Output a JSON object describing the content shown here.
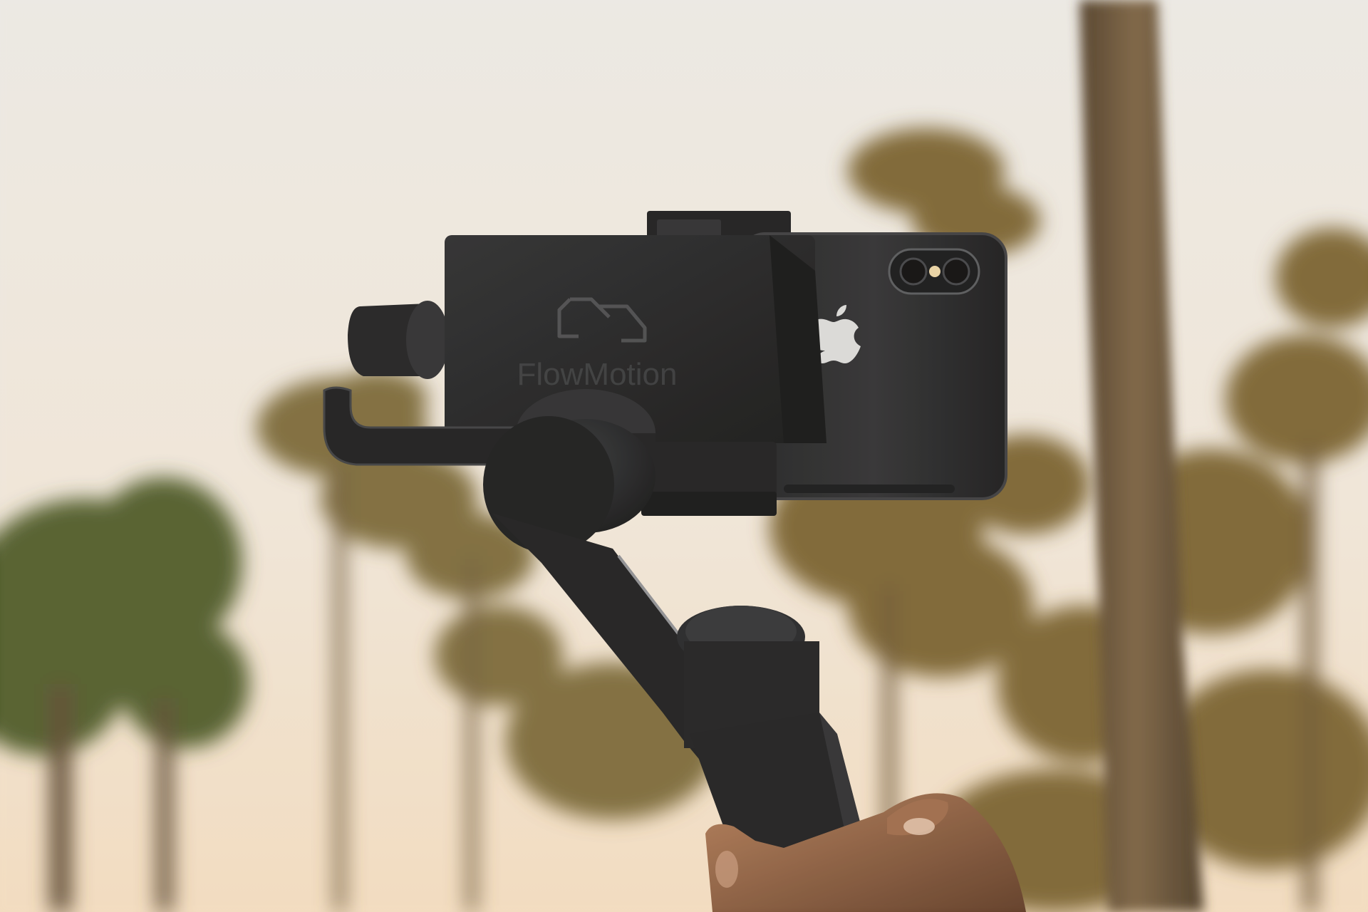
{
  "photo": {
    "subject": "handheld-gimbal-stabilizer-with-smartphone",
    "setting": "palm-trees-sunset-sky",
    "brand_mark": {
      "wordmark": "FlowMotion",
      "monogram": "CF"
    },
    "colors": {
      "sky_top": "#ece9e3",
      "sky_bottom": "#f1dcc2",
      "palm_foliage": "#6f5a2c",
      "palm_foliage_green": "#55612f",
      "trunk": "#6b5437",
      "gimbal_body": "#1f2022",
      "gimbal_highlight": "#4a4c50",
      "phone_back": "#2a2b2e",
      "skin": "#8a5a3e"
    }
  }
}
